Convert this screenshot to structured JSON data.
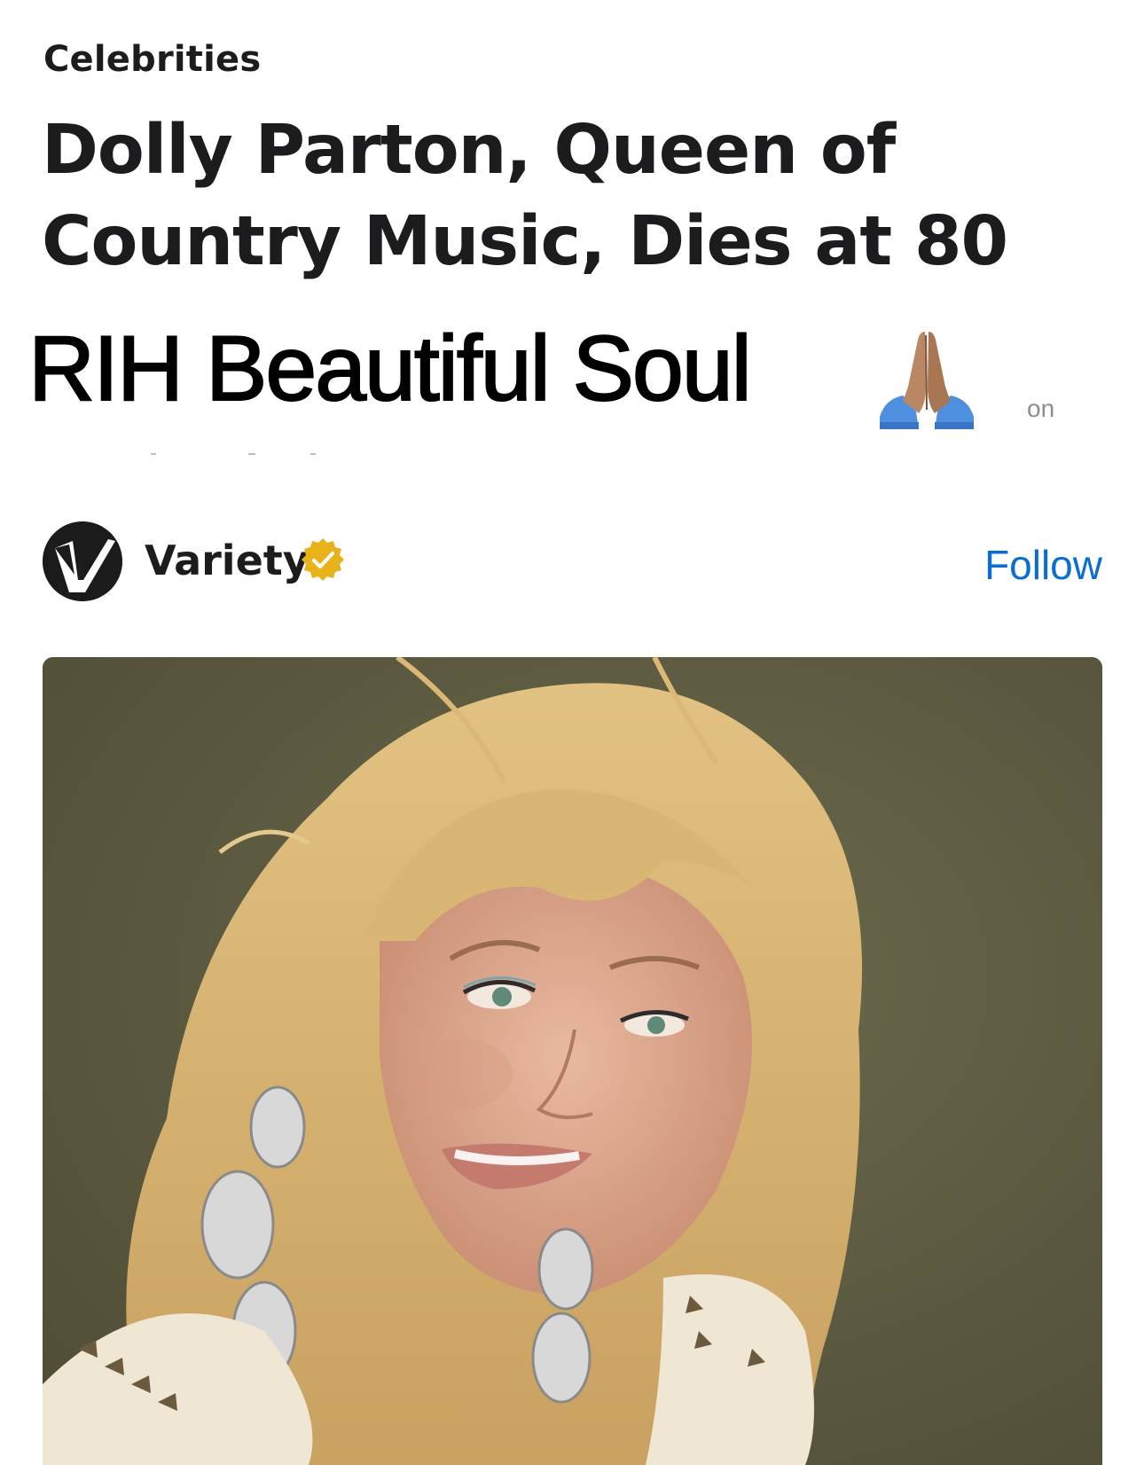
{
  "article": {
    "category": "Celebrities",
    "headline": "Dolly Parton, Queen of Country Music, Dies at 80"
  },
  "overlay": {
    "caption": "RIH Beautiful Soul",
    "emoji_icon": "folded-hands-icon",
    "trailing_text": "on"
  },
  "publisher": {
    "name": "Variety",
    "logo_icon": "variety-logo-icon",
    "verified_icon": "verified-badge-icon",
    "follow_label": "Follow"
  },
  "colors": {
    "accent": "#0a6ed1",
    "verified": "#e8b21a",
    "text": "#1c1c1e",
    "photo_background": "#5c5a40"
  }
}
